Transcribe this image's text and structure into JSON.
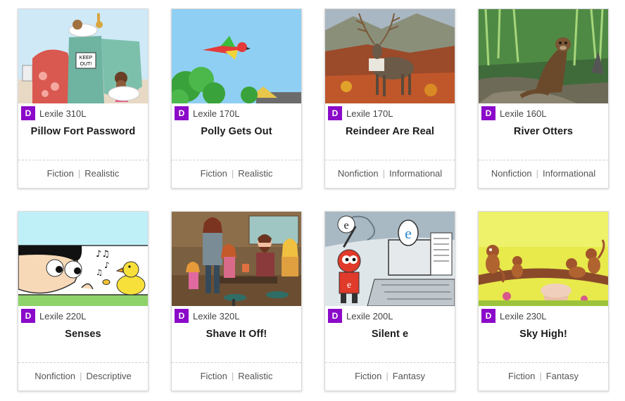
{
  "level_badge": "D",
  "colors": {
    "badge": "#8b0ac9"
  },
  "books": [
    {
      "title": "Pillow Fort Password",
      "lexile": "Lexile 310L",
      "genre": "Fiction",
      "subgenre": "Realistic",
      "image": "pillow-fort-illustration"
    },
    {
      "title": "Polly Gets Out",
      "lexile": "Lexile 170L",
      "genre": "Fiction",
      "subgenre": "Realistic",
      "image": "flying-parrot-illustration"
    },
    {
      "title": "Reindeer Are Real",
      "lexile": "Lexile 170L",
      "genre": "Nonfiction",
      "subgenre": "Informational",
      "image": "reindeer-photo"
    },
    {
      "title": "River Otters",
      "lexile": "Lexile 160L",
      "genre": "Nonfiction",
      "subgenre": "Informational",
      "image": "river-otter-photo"
    },
    {
      "title": "Senses",
      "lexile": "Lexile 220L",
      "genre": "Nonfiction",
      "subgenre": "Descriptive",
      "image": "boy-and-singing-bird-illustration"
    },
    {
      "title": "Shave It Off!",
      "lexile": "Lexile 320L",
      "genre": "Fiction",
      "subgenre": "Realistic",
      "image": "family-kitchen-illustration"
    },
    {
      "title": "Silent e",
      "lexile": "Lexile 200L",
      "genre": "Fiction",
      "subgenre": "Fantasy",
      "image": "letter-e-robot-illustration"
    },
    {
      "title": "Sky High!",
      "lexile": "Lexile 230L",
      "genre": "Fiction",
      "subgenre": "Fantasy",
      "image": "monkeys-on-branch-illustration"
    }
  ]
}
